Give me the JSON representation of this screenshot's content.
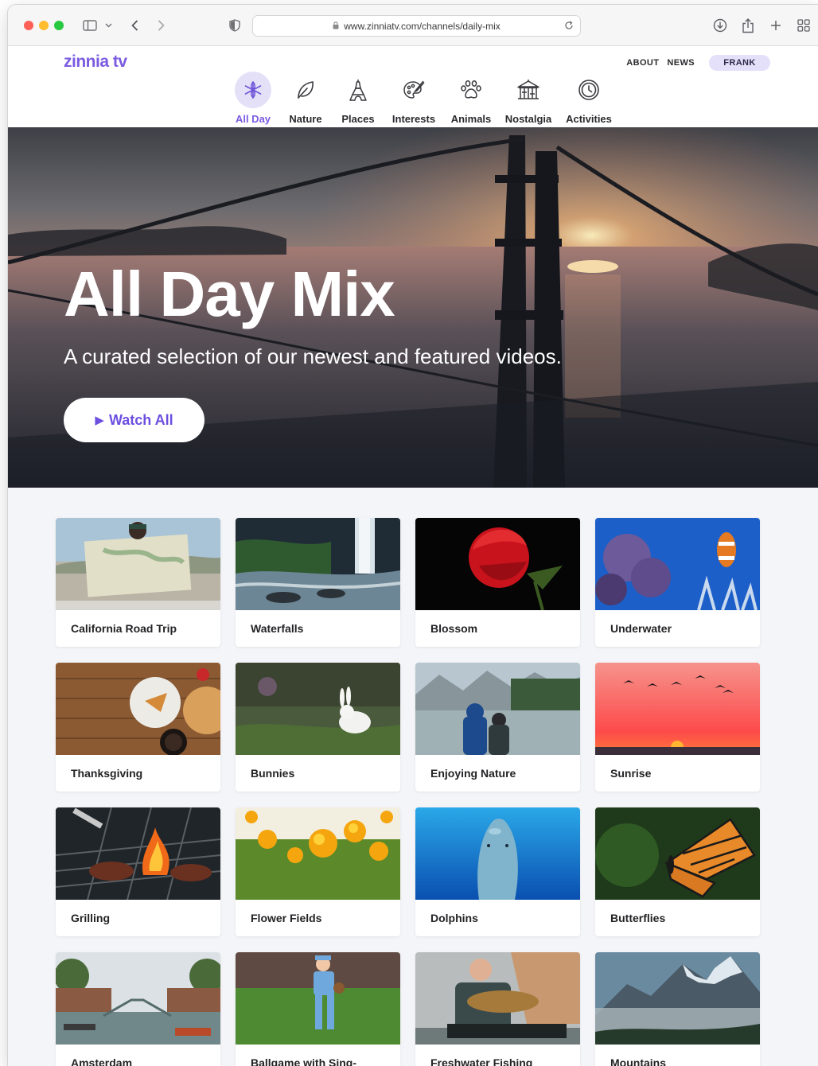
{
  "browser": {
    "url": "www.zinniatv.com/channels/daily-mix"
  },
  "site": {
    "logo": "zinnia tv",
    "links": [
      "ABOUT",
      "NEWS"
    ],
    "user": "FRANK"
  },
  "categories": [
    {
      "label": "All Day",
      "icon": "sparkle-icon",
      "active": true
    },
    {
      "label": "Nature",
      "icon": "leaf-icon",
      "active": false
    },
    {
      "label": "Places",
      "icon": "eiffel-tower-icon",
      "active": false
    },
    {
      "label": "Interests",
      "icon": "palette-icon",
      "active": false
    },
    {
      "label": "Animals",
      "icon": "paw-icon",
      "active": false
    },
    {
      "label": "Nostalgia",
      "icon": "carousel-icon",
      "active": false
    },
    {
      "label": "Activities",
      "icon": "clock-icon",
      "active": false
    }
  ],
  "hero": {
    "title": "All Day Mix",
    "subtitle": "A curated selection of our newest and featured videos.",
    "button": "Watch All"
  },
  "videos": [
    "California Road Trip",
    "Waterfalls",
    "Blossom",
    "Underwater",
    "Thanksgiving",
    "Bunnies",
    "Enjoying Nature",
    "Sunrise",
    "Grilling",
    "Flower Fields",
    "Dolphins",
    "Butterflies",
    "Amsterdam",
    "Ballgame with Sing-",
    "Freshwater Fishing",
    "Mountains"
  ],
  "colors": {
    "brand": "#7b5ce0",
    "active_pill": "#e4e0f7",
    "page_bg": "#f4f5f8"
  }
}
